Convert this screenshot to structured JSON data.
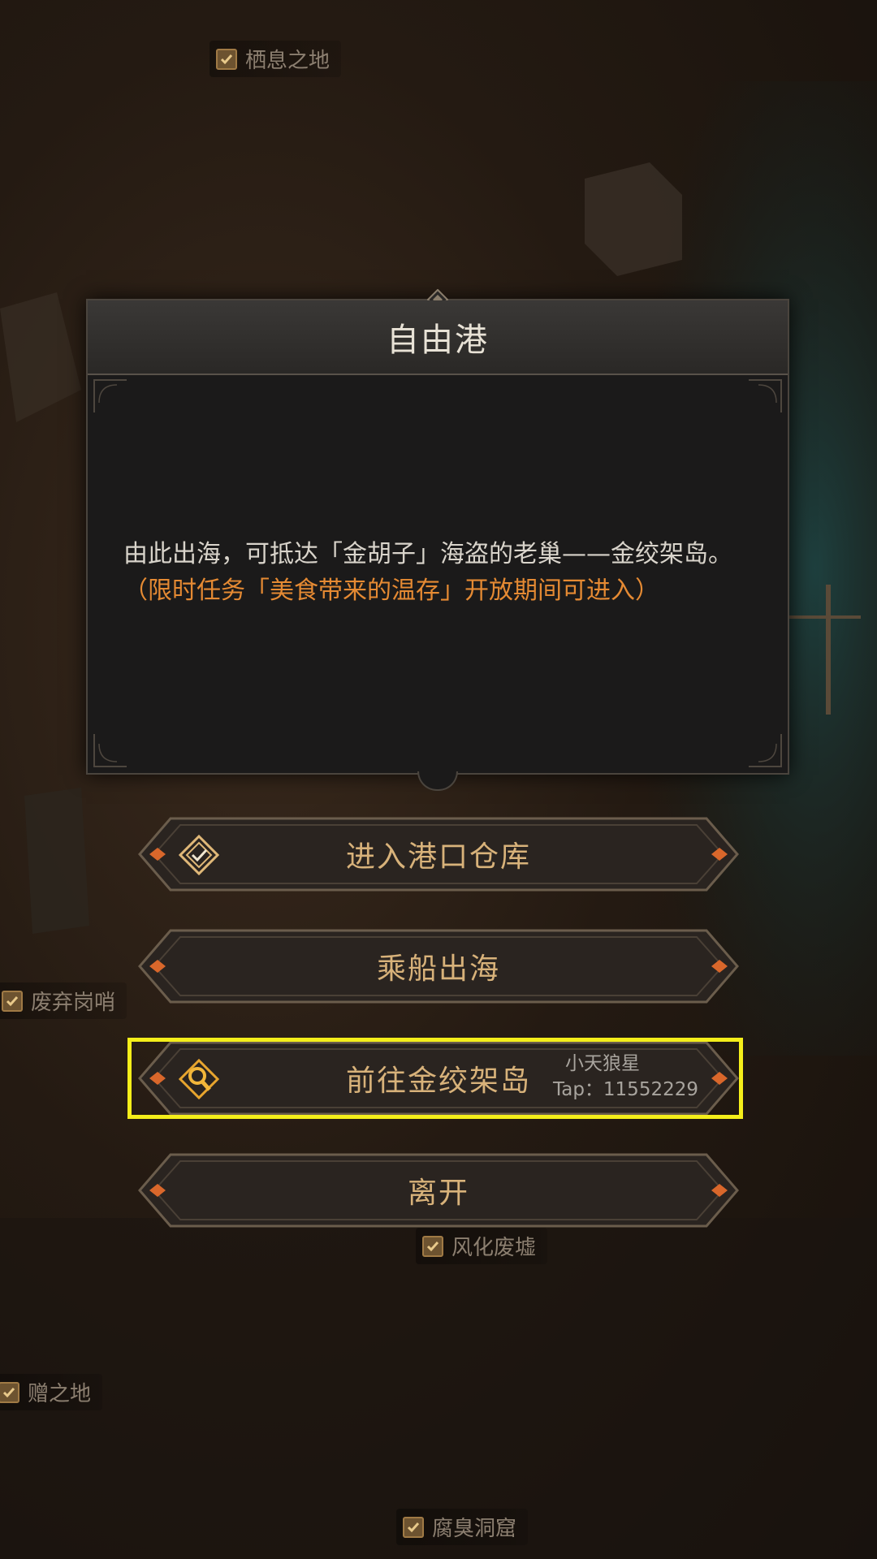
{
  "map_labels": {
    "resting_place": "栖息之地",
    "abandoned_post": "废弃岗哨",
    "weathered_ruins": "风化废墟",
    "gift_land": "赠之地",
    "stench_cave": "腐臭洞窟"
  },
  "dialog": {
    "title": "自由港",
    "description": "由此出海，可抵达「金胡子」海盗的老巢——金绞架岛。",
    "note_open": "（",
    "note_highlight": "限时任务「美食带来的温存」开放期间可进入",
    "note_close": "）"
  },
  "buttons": {
    "warehouse": "进入港口仓库",
    "sail": "乘船出海",
    "goto_island": "前往金绞架岛",
    "leave": "离开"
  },
  "watermark": {
    "name": "小天狼星",
    "tap": "Tap：11552229"
  },
  "colors": {
    "accent_orange": "#e58a33",
    "button_text": "#d8b27a",
    "highlight_box": "#f4ee1a"
  },
  "icons": {
    "warehouse": "diamond-check-icon",
    "goto_island": "magnifier-scroll-icon",
    "map_label": "check-icon"
  }
}
